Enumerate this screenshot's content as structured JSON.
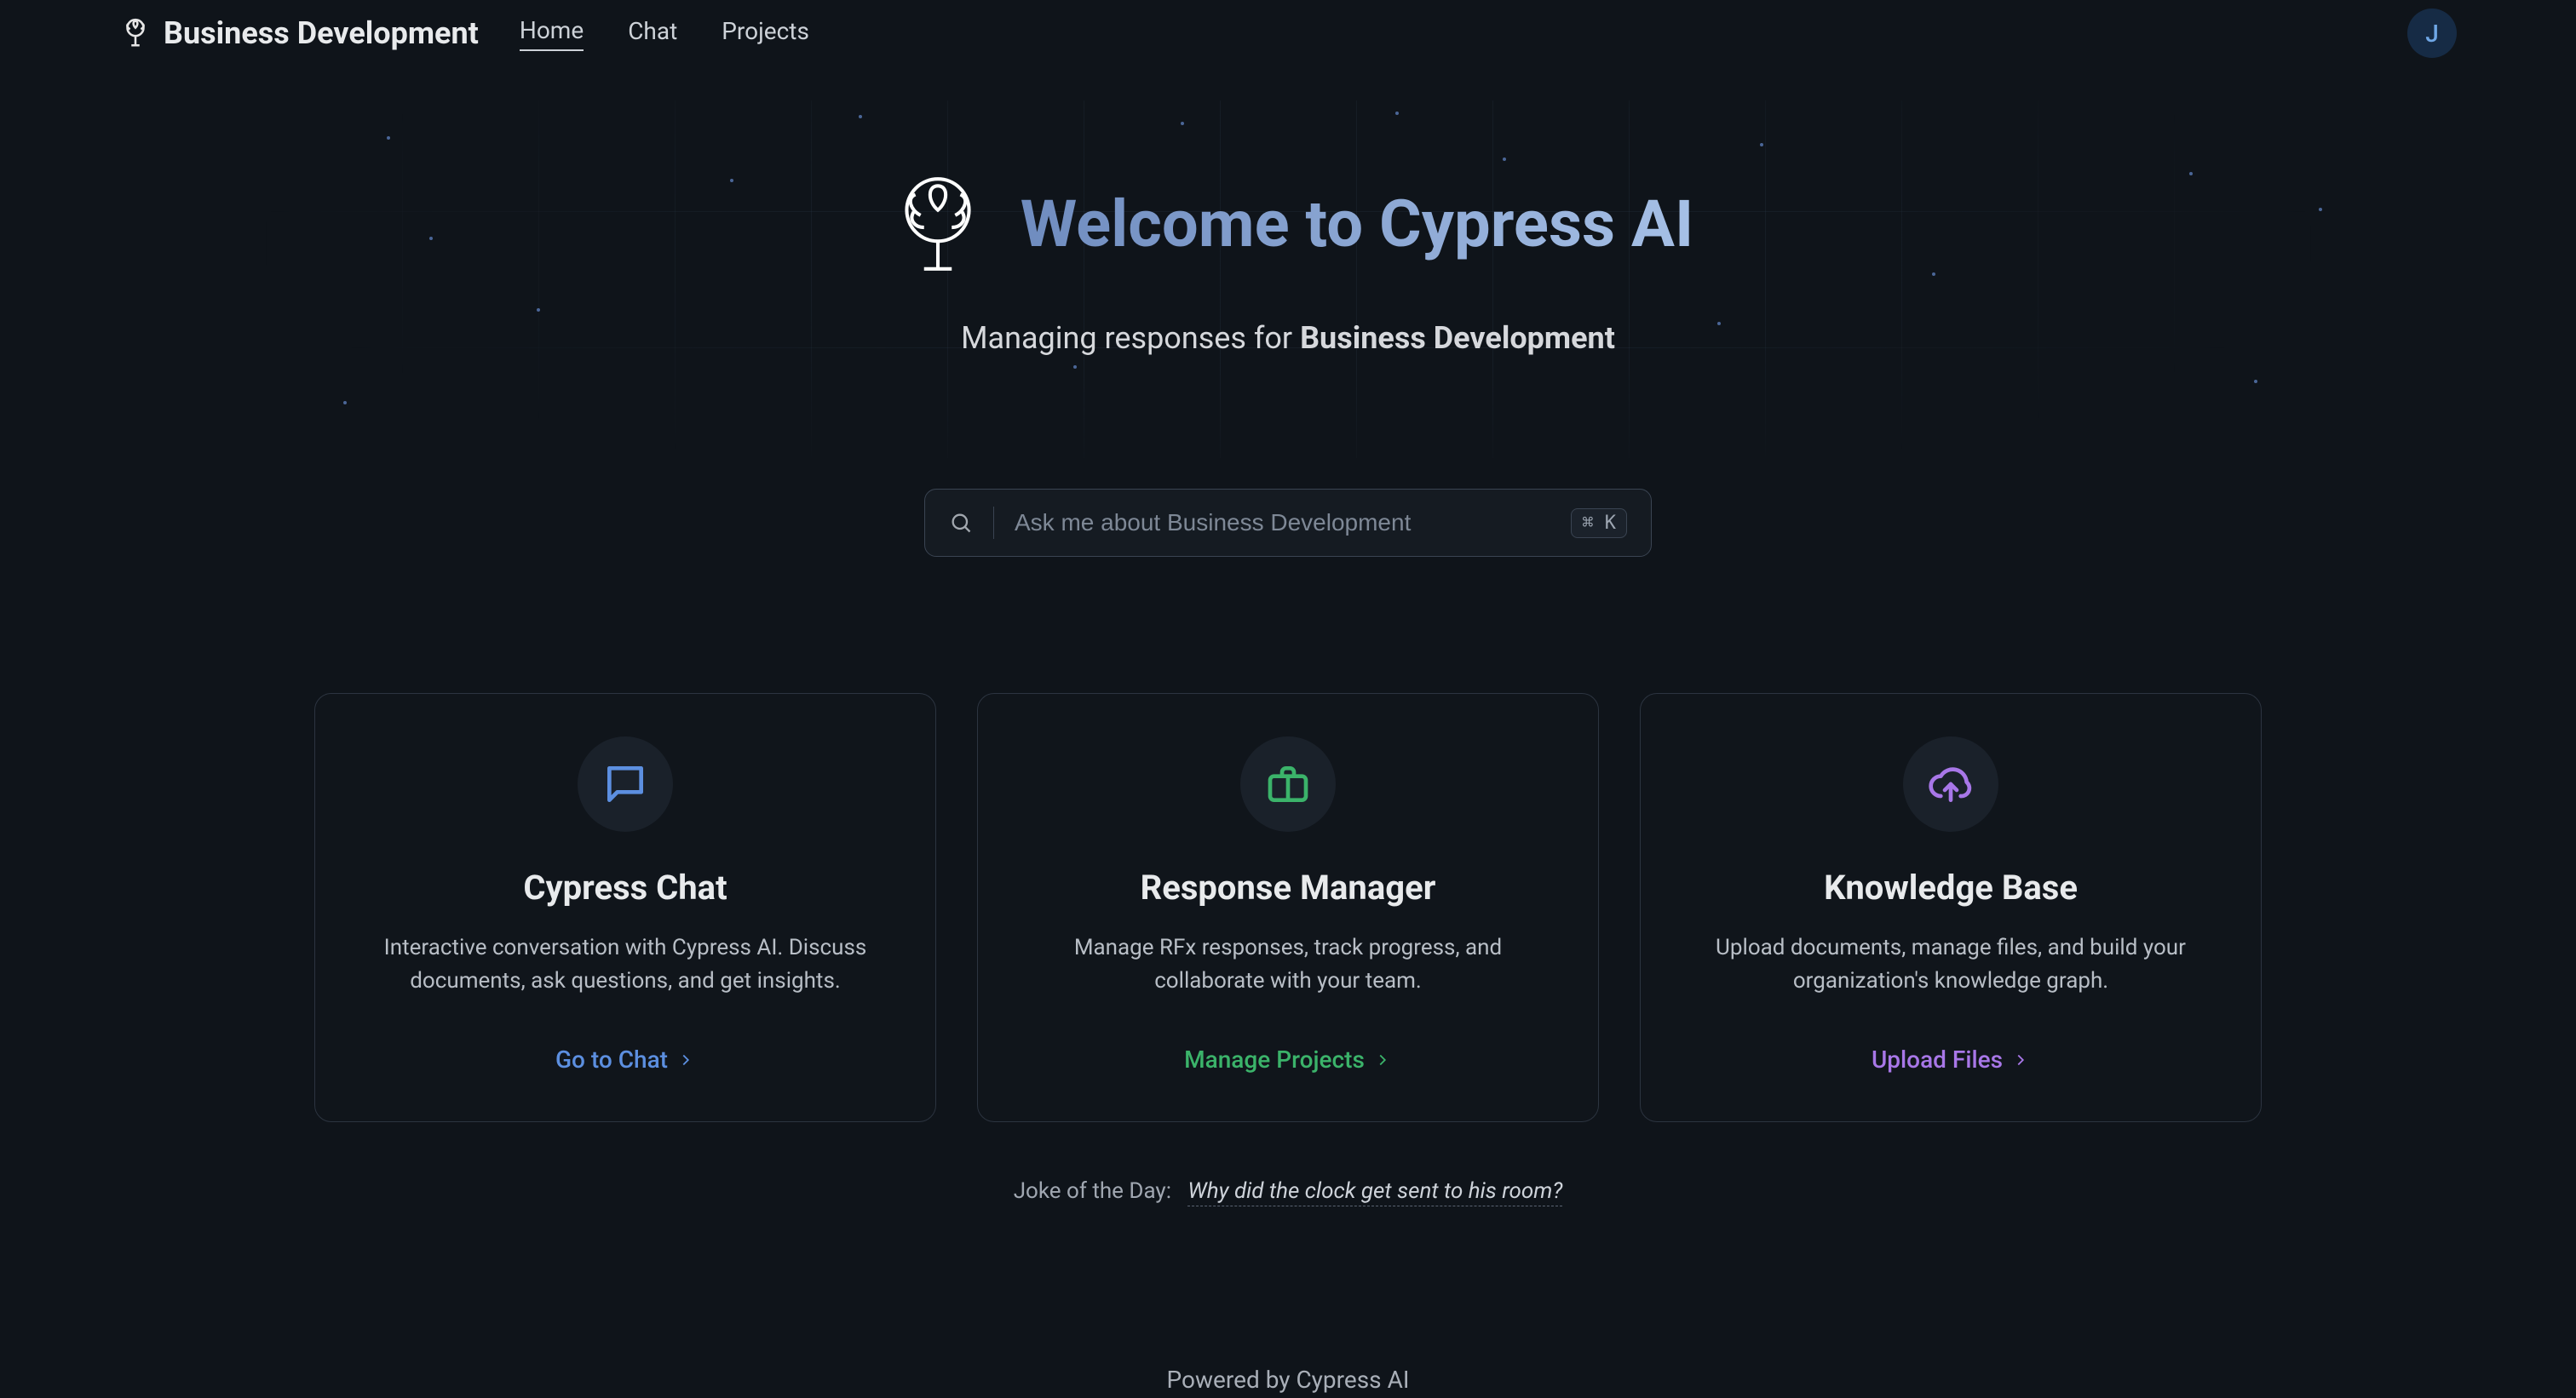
{
  "header": {
    "brand_name": "Business Development",
    "nav": {
      "home": "Home",
      "chat": "Chat",
      "projects": "Projects"
    },
    "avatar_initial": "J"
  },
  "hero": {
    "title": "Welcome to Cypress AI",
    "subtitle_prefix": "Managing responses for ",
    "subtitle_org": "Business Development"
  },
  "search": {
    "placeholder": "Ask me about Business Development",
    "shortcut": "⌘ K"
  },
  "cards": [
    {
      "title": "Cypress Chat",
      "desc": "Interactive conversation with Cypress AI. Discuss documents, ask questions, and get insights.",
      "link": "Go to Chat",
      "icon": "message-square-icon",
      "link_color": "blue"
    },
    {
      "title": "Response Manager",
      "desc": "Manage RFx responses, track progress, and collaborate with your team.",
      "link": "Manage Projects",
      "icon": "briefcase-icon",
      "link_color": "green"
    },
    {
      "title": "Knowledge Base",
      "desc": "Upload documents, manage files, and build your organization's knowledge graph.",
      "link": "Upload Files",
      "icon": "cloud-upload-icon",
      "link_color": "purple"
    }
  ],
  "joke": {
    "label": "Joke of the Day:",
    "setup": "Why did the clock get sent to his room?"
  },
  "footer": "Powered by Cypress AI",
  "colors": {
    "blue": "#5c8fe0",
    "green": "#3bb36a",
    "purple": "#a877e8"
  }
}
